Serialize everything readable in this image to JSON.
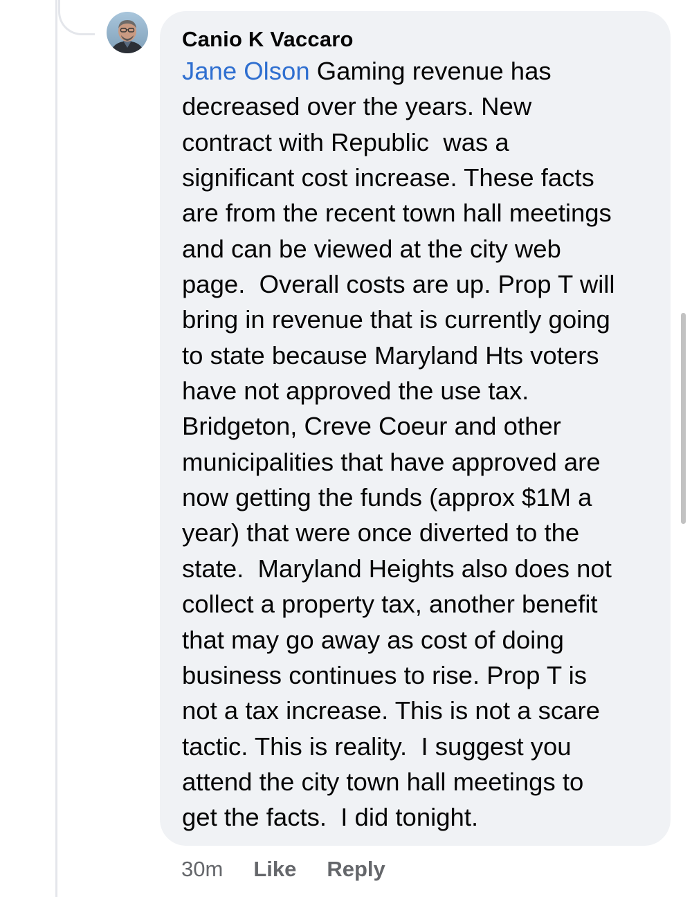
{
  "comment": {
    "author": "Canio K Vaccaro",
    "mention": "Jane Olson",
    "first_line_rest": " Gaming revenue has",
    "lines": [
      "decreased over the years. New",
      "contract with Republic  was a",
      "significant cost increase. These facts",
      "are from the recent town hall meetings",
      "and can be viewed at the city web",
      "page.  Overall costs are up. Prop T will",
      "bring in revenue that is currently going",
      "to state because Maryland Hts voters",
      "have not approved the use tax.",
      "Bridgeton, Creve Coeur and other",
      "municipalities that have approved are",
      "now getting the funds (approx $1M a",
      "year) that were once diverted to the",
      "state.  Maryland Heights also does not",
      "collect a property tax, another benefit",
      "that may go away as cost of doing",
      "business continues to rise. Prop T is",
      "not a tax increase. This is not a scare",
      "tactic. This is reality.  I suggest you",
      "attend the city town hall meetings to",
      "get the facts.  I did tonight."
    ],
    "avatar_icon": "user-avatar-photo"
  },
  "actions": {
    "timestamp": "30m",
    "like_label": "Like",
    "reply_label": "Reply"
  },
  "colors": {
    "bubble_bg": "#f0f2f5",
    "mention": "#2f6fd0",
    "meta_text": "#65676b",
    "thread_line": "#e4e6eb"
  }
}
